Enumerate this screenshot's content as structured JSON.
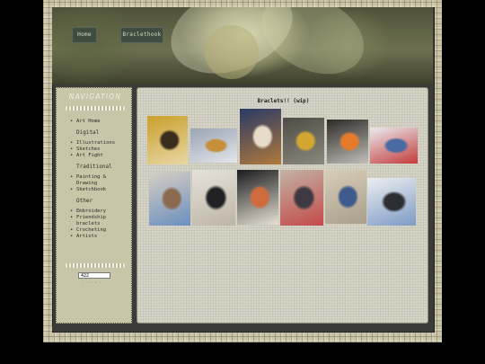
{
  "header": {
    "buttons": [
      "Home",
      "Braclethook"
    ]
  },
  "sidebar": {
    "title": "NAVIGATION",
    "items": [
      {
        "kind": "item",
        "label": "Art Home"
      },
      {
        "kind": "section",
        "label": "Digital"
      },
      {
        "kind": "item",
        "label": "Illustrations"
      },
      {
        "kind": "item",
        "label": "Sketches"
      },
      {
        "kind": "item",
        "label": "Art Fight"
      },
      {
        "kind": "section",
        "label": "Traditional"
      },
      {
        "kind": "item",
        "label": "Painting & Drawing"
      },
      {
        "kind": "item",
        "label": "Sketchbook"
      },
      {
        "kind": "section",
        "label": "Other"
      },
      {
        "kind": "item",
        "label": "Embroidery"
      },
      {
        "kind": "item",
        "label": "Friendship braclets"
      },
      {
        "kind": "item",
        "label": "Crocheting"
      },
      {
        "kind": "item",
        "label": "Artists"
      }
    ],
    "counter_value": "422"
  },
  "main": {
    "title": "Braclets!! (wip)",
    "gallery_row1": [
      {
        "name": "photo-keychain-yellow-bag",
        "colors": [
          "#c9a02b",
          "#3b2d1d",
          "#e8d7a5"
        ]
      },
      {
        "name": "photo-keychain-on-desk",
        "colors": [
          "#9aa4b4",
          "#c78f3a",
          "#e4e6ea"
        ]
      },
      {
        "name": "photo-hanging-pattern-portrait",
        "colors": [
          "#2a3a66",
          "#e7dcc9",
          "#b0793c"
        ]
      },
      {
        "name": "photo-beaded-charm-gravel",
        "colors": [
          "#4e4c45",
          "#d3a632",
          "#8b897d"
        ]
      },
      {
        "name": "photo-orange-charm-dark",
        "colors": [
          "#2e2a28",
          "#e57b2a",
          "#c0bfb9"
        ]
      },
      {
        "name": "photo-long-bracelet-white",
        "colors": [
          "#e9ebef",
          "#4a6aa3",
          "#c53b3b"
        ]
      }
    ],
    "gallery_row2": [
      {
        "name": "photo-bracelet-cat",
        "colors": [
          "#d7cfc4",
          "#8c6a4f",
          "#6b8fbf"
        ]
      },
      {
        "name": "photo-skull-bracelet",
        "colors": [
          "#e6e2d9",
          "#222",
          "#bdb6a7"
        ]
      },
      {
        "name": "photo-cat-charm-dark",
        "colors": [
          "#1b1b1d",
          "#cf6b3c",
          "#e6e1d4"
        ]
      },
      {
        "name": "photo-bracelet-on-arm",
        "colors": [
          "#c2b3a3",
          "#3d3a44",
          "#c44a4a"
        ]
      },
      {
        "name": "photo-blue-bracelet-bed",
        "colors": [
          "#d8cdb7",
          "#3f5a8c",
          "#aa9f8b"
        ]
      },
      {
        "name": "photo-hanging-charm-white",
        "colors": [
          "#eceef0",
          "#2d2e33",
          "#7c9bc5"
        ]
      }
    ]
  }
}
